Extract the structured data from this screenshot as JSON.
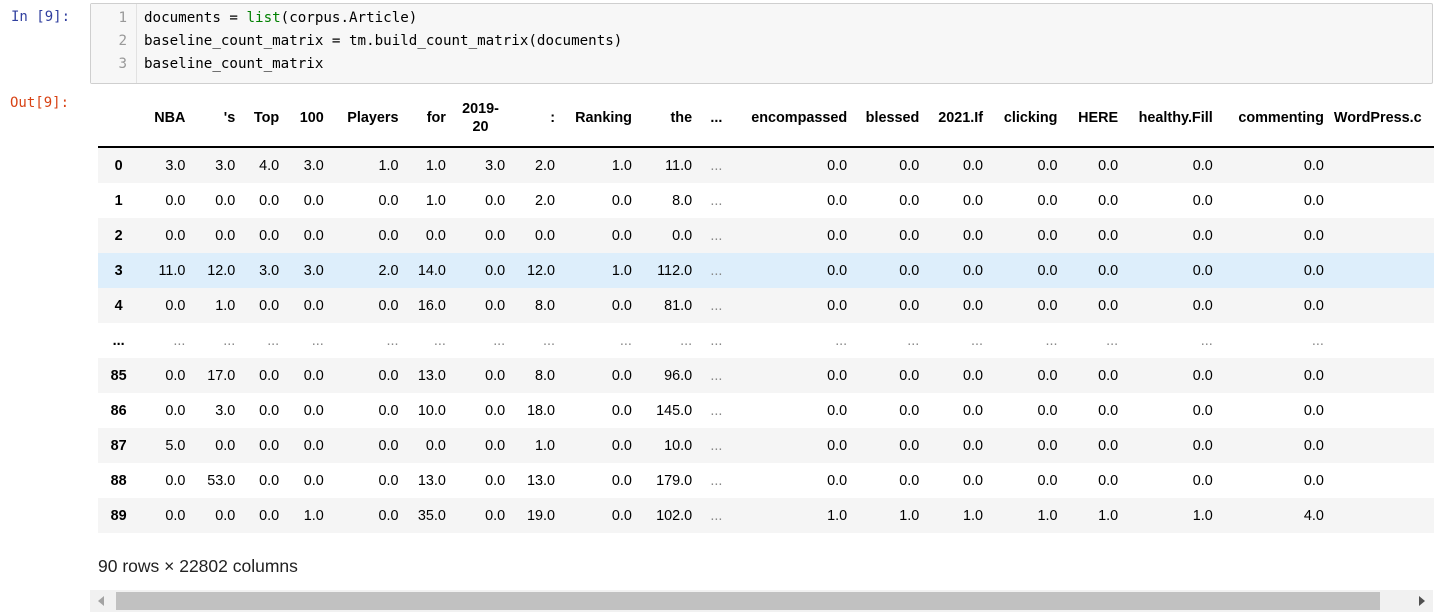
{
  "input_prompt": "In [9]:",
  "output_prompt": "Out[9]:",
  "code_lines": [
    {
      "num": "1",
      "parts": [
        {
          "t": "documents = ",
          "c": ""
        },
        {
          "t": "list",
          "c": "bi"
        },
        {
          "t": "(corpus.Article)",
          "c": ""
        }
      ]
    },
    {
      "num": "2",
      "parts": [
        {
          "t": "baseline_count_matrix = tm.build_count_matrix(documents)",
          "c": ""
        }
      ]
    },
    {
      "num": "3",
      "parts": [
        {
          "t": "baseline_count_matrix",
          "c": ""
        }
      ]
    }
  ],
  "table": {
    "columns": [
      "",
      "NBA",
      "'s",
      "Top",
      "100",
      "Players",
      "for",
      "2019-\n20",
      ":",
      "Ranking",
      "the",
      "...",
      "encompassed",
      "blessed",
      "2021.If",
      "clicking",
      "HERE",
      "healthy.Fill",
      "commenting",
      "WordPress.c"
    ],
    "rows": [
      {
        "index": "0",
        "values": [
          "3.0",
          "3.0",
          "4.0",
          "3.0",
          "1.0",
          "1.0",
          "3.0",
          "2.0",
          "1.0",
          "11.0",
          "...",
          "0.0",
          "0.0",
          "0.0",
          "0.0",
          "0.0",
          "0.0",
          "0.0",
          ""
        ]
      },
      {
        "index": "1",
        "values": [
          "0.0",
          "0.0",
          "0.0",
          "0.0",
          "0.0",
          "1.0",
          "0.0",
          "2.0",
          "0.0",
          "8.0",
          "...",
          "0.0",
          "0.0",
          "0.0",
          "0.0",
          "0.0",
          "0.0",
          "0.0",
          ""
        ]
      },
      {
        "index": "2",
        "values": [
          "0.0",
          "0.0",
          "0.0",
          "0.0",
          "0.0",
          "0.0",
          "0.0",
          "0.0",
          "0.0",
          "0.0",
          "...",
          "0.0",
          "0.0",
          "0.0",
          "0.0",
          "0.0",
          "0.0",
          "0.0",
          ""
        ]
      },
      {
        "index": "3",
        "values": [
          "11.0",
          "12.0",
          "3.0",
          "3.0",
          "2.0",
          "14.0",
          "0.0",
          "12.0",
          "1.0",
          "112.0",
          "...",
          "0.0",
          "0.0",
          "0.0",
          "0.0",
          "0.0",
          "0.0",
          "0.0",
          ""
        ],
        "highlight": true
      },
      {
        "index": "4",
        "values": [
          "0.0",
          "1.0",
          "0.0",
          "0.0",
          "0.0",
          "16.0",
          "0.0",
          "8.0",
          "0.0",
          "81.0",
          "...",
          "0.0",
          "0.0",
          "0.0",
          "0.0",
          "0.0",
          "0.0",
          "0.0",
          ""
        ]
      },
      {
        "index": "...",
        "values": [
          "...",
          "...",
          "...",
          "...",
          "...",
          "...",
          "...",
          "...",
          "...",
          "...",
          "...",
          "...",
          "...",
          "...",
          "...",
          "...",
          "...",
          "...",
          ""
        ]
      },
      {
        "index": "85",
        "values": [
          "0.0",
          "17.0",
          "0.0",
          "0.0",
          "0.0",
          "13.0",
          "0.0",
          "8.0",
          "0.0",
          "96.0",
          "...",
          "0.0",
          "0.0",
          "0.0",
          "0.0",
          "0.0",
          "0.0",
          "0.0",
          ""
        ]
      },
      {
        "index": "86",
        "values": [
          "0.0",
          "3.0",
          "0.0",
          "0.0",
          "0.0",
          "10.0",
          "0.0",
          "18.0",
          "0.0",
          "145.0",
          "...",
          "0.0",
          "0.0",
          "0.0",
          "0.0",
          "0.0",
          "0.0",
          "0.0",
          ""
        ]
      },
      {
        "index": "87",
        "values": [
          "5.0",
          "0.0",
          "0.0",
          "0.0",
          "0.0",
          "0.0",
          "0.0",
          "1.0",
          "0.0",
          "10.0",
          "...",
          "0.0",
          "0.0",
          "0.0",
          "0.0",
          "0.0",
          "0.0",
          "0.0",
          ""
        ]
      },
      {
        "index": "88",
        "values": [
          "0.0",
          "53.0",
          "0.0",
          "0.0",
          "0.0",
          "13.0",
          "0.0",
          "13.0",
          "0.0",
          "179.0",
          "...",
          "0.0",
          "0.0",
          "0.0",
          "0.0",
          "0.0",
          "0.0",
          "0.0",
          ""
        ]
      },
      {
        "index": "89",
        "values": [
          "0.0",
          "0.0",
          "0.0",
          "1.0",
          "0.0",
          "35.0",
          "0.0",
          "19.0",
          "0.0",
          "102.0",
          "...",
          "1.0",
          "1.0",
          "1.0",
          "1.0",
          "1.0",
          "1.0",
          "4.0",
          ""
        ]
      }
    ]
  },
  "shape_text": "90 rows × 22802 columns",
  "icons": {
    "scroll_left": "chevron-left-icon",
    "scroll_right": "chevron-right-icon"
  }
}
